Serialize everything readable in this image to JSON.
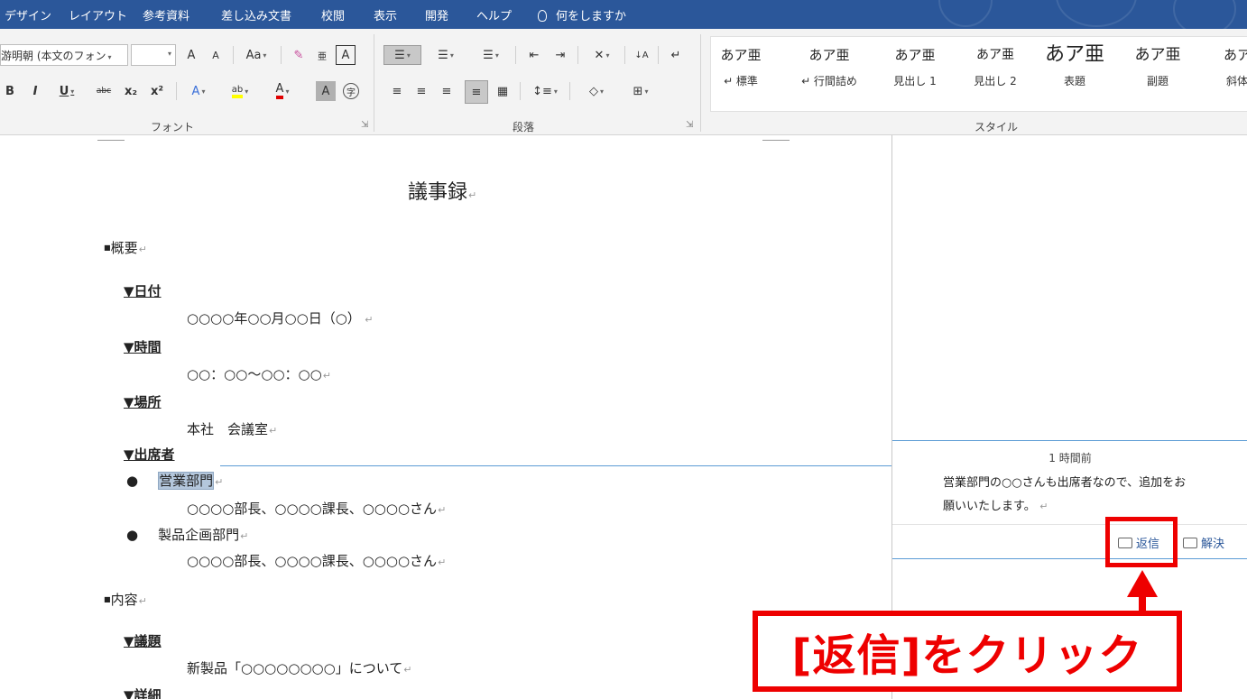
{
  "ribbon_tabs": [
    "デザイン",
    "レイアウト",
    "参考資料",
    "差し込み文書",
    "校閲",
    "表示",
    "開発",
    "ヘルプ"
  ],
  "tell_me": "何をしますか",
  "font": {
    "name": "游明朝 (本文のフォン",
    "size": "",
    "group_label": "フォント",
    "buttons": [
      "A",
      "A",
      "Aa",
      "B",
      "I",
      "U",
      "abc",
      "x₂",
      "x²",
      "A",
      "ab",
      "A",
      "A",
      "字"
    ]
  },
  "paragraph": {
    "group_label": "段落"
  },
  "styles": {
    "group_label": "スタイル",
    "items": [
      {
        "preview": "あア亜",
        "name": "↵ 標準"
      },
      {
        "preview": "あア亜",
        "name": "↵ 行間詰め"
      },
      {
        "preview": "あア亜",
        "name": "見出し 1"
      },
      {
        "preview": "あア亜",
        "name": "見出し 2"
      },
      {
        "preview": "あア亜",
        "name": "表題"
      },
      {
        "preview": "あア亜",
        "name": "副題"
      },
      {
        "preview": "あア",
        "name": "斜体"
      }
    ]
  },
  "document": {
    "title": "議事録",
    "section1": "概要",
    "date_label": "▼日付",
    "date_value": "○○○○年○○月○○日（○）",
    "time_label": "▼時間",
    "time_value": "○○：○○～○○：○○",
    "place_label": "▼場所",
    "place_value": "本社　会議室",
    "attendees_label": "▼出席者",
    "dept1": "営業部門",
    "dept1_members": "○○○○部長、○○○○課長、○○○○さん",
    "dept2": "製品企画部門",
    "dept2_members": "○○○○部長、○○○○課長、○○○○さん",
    "section2": "内容",
    "agenda_label": "▼議題",
    "agenda_value": "新製品「○○○○○○○○」について",
    "details_label": "▼詳細"
  },
  "comment": {
    "time": "1 時間前",
    "line1": "営業部門の○○さんも出席者なので、追加をお",
    "line2": "願いいたします。",
    "reply_label": "返信",
    "resolve_label": "解決"
  },
  "annotation": {
    "callout": "[返信]をクリック"
  },
  "colors": {
    "ribbon_blue": "#2b579a",
    "highlight_red": "#ee0000",
    "connector_blue": "#5b9bd5"
  }
}
